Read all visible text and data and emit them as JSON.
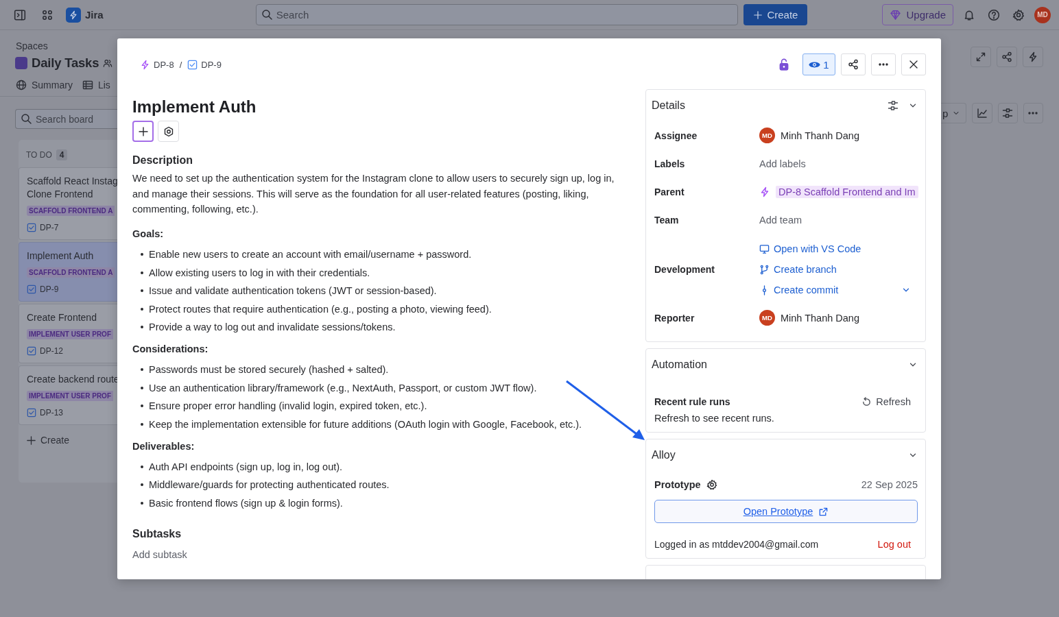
{
  "top_bar": {
    "app_name": "Jira",
    "search": {
      "placeholder": "Search"
    },
    "create_button": "Create",
    "upgrade_button": "Upgrade",
    "avatar": "MD"
  },
  "space": {
    "breadcrumb": "Spaces",
    "title": "Daily Tasks",
    "tabs": [
      {
        "label": "Summary",
        "kind": "summary",
        "selected": false
      },
      {
        "label": "Lis",
        "kind": "list",
        "selected": false
      }
    ]
  },
  "board": {
    "search": {
      "placeholder": "Search board"
    },
    "toolbar_button": "p",
    "column": {
      "title": "TO DO",
      "count": "4",
      "cards": [
        {
          "title": "Scaffold React Instag\nClone Frontend",
          "tag": "SCAFFOLD FRONTEND A",
          "key": "DP-7",
          "selected": false
        },
        {
          "title": "Implement Auth",
          "tag": "SCAFFOLD FRONTEND A",
          "key": "DP-9",
          "selected": true
        },
        {
          "title": "Create Frontend",
          "tag": "IMPLEMENT USER PROF",
          "key": "DP-12",
          "selected": false
        },
        {
          "title": "Create backend route",
          "tag": "IMPLEMENT USER PROF",
          "key": "DP-13",
          "selected": false
        }
      ],
      "create": "Create"
    }
  },
  "issue": {
    "breadcrumb_separator": "/",
    "breadcrumb": [
      {
        "key": "DP-8",
        "kind": "epic"
      },
      {
        "key": "DP-9",
        "kind": "task"
      }
    ],
    "watchers": "1",
    "title": "Implement Auth",
    "description": {
      "heading": "Description",
      "intro": "We need to set up the authentication system for the Instagram clone to allow users to securely sign up, log in, and manage their sessions. This will serve as the foundation for all user-related features (posting, liking, commenting, following, etc.).",
      "sections": [
        {
          "heading": "Goals:",
          "items": [
            "Enable new users to create an account with email/username + password.",
            "Allow existing users to log in with their credentials.",
            "Issue and validate authentication tokens (JWT or session-based).",
            "Protect routes that require authentication (e.g., posting a photo, viewing feed).",
            "Provide a way to log out and invalidate sessions/tokens."
          ]
        },
        {
          "heading": "Considerations:",
          "items": [
            "Passwords must be stored securely (hashed + salted).",
            "Use an authentication library/framework (e.g., NextAuth, Passport, or custom JWT flow).",
            "Ensure proper error handling (invalid login, expired token, etc.).",
            "Keep the implementation extensible for future additions (OAuth login with Google, Facebook, etc.)."
          ]
        },
        {
          "heading": "Deliverables:",
          "items": [
            "Auth API endpoints (sign up, log in, log out).",
            "Middleware/guards for protecting authenticated routes.",
            "Basic frontend flows (sign up & login forms)."
          ]
        }
      ]
    },
    "subtasks": {
      "heading": "Subtasks",
      "add": "Add subtask"
    }
  },
  "details": {
    "title": "Details",
    "fields": [
      {
        "label": "Assignee",
        "kind": "person",
        "value": "Minh Thanh Dang",
        "avatar": "MD"
      },
      {
        "label": "Labels",
        "kind": "empty",
        "value": "Add labels"
      },
      {
        "label": "Parent",
        "kind": "parent",
        "value": "DP-8 Scaffold Frontend and Im"
      },
      {
        "label": "Team",
        "kind": "empty",
        "value": "Add team"
      },
      {
        "label": "Development",
        "kind": "links",
        "links": [
          {
            "kind": "vscode",
            "label": "Open with VS Code"
          },
          {
            "kind": "branch",
            "label": "Create branch"
          },
          {
            "kind": "commit",
            "label": "Create commit"
          }
        ]
      },
      {
        "label": "Reporter",
        "kind": "person",
        "value": "Minh Thanh Dang",
        "avatar": "MD"
      }
    ]
  },
  "automation": {
    "title": "Automation",
    "subtitle": "Recent rule runs",
    "refresh": "Refresh",
    "note": "Refresh to see recent runs."
  },
  "alloy": {
    "title": "Alloy",
    "prototype_label": "Prototype",
    "date": "22 Sep 2025",
    "open_button": "Open Prototype",
    "logged_in": "Logged in as mtddev2004@gmail.com",
    "logout": "Log out"
  }
}
